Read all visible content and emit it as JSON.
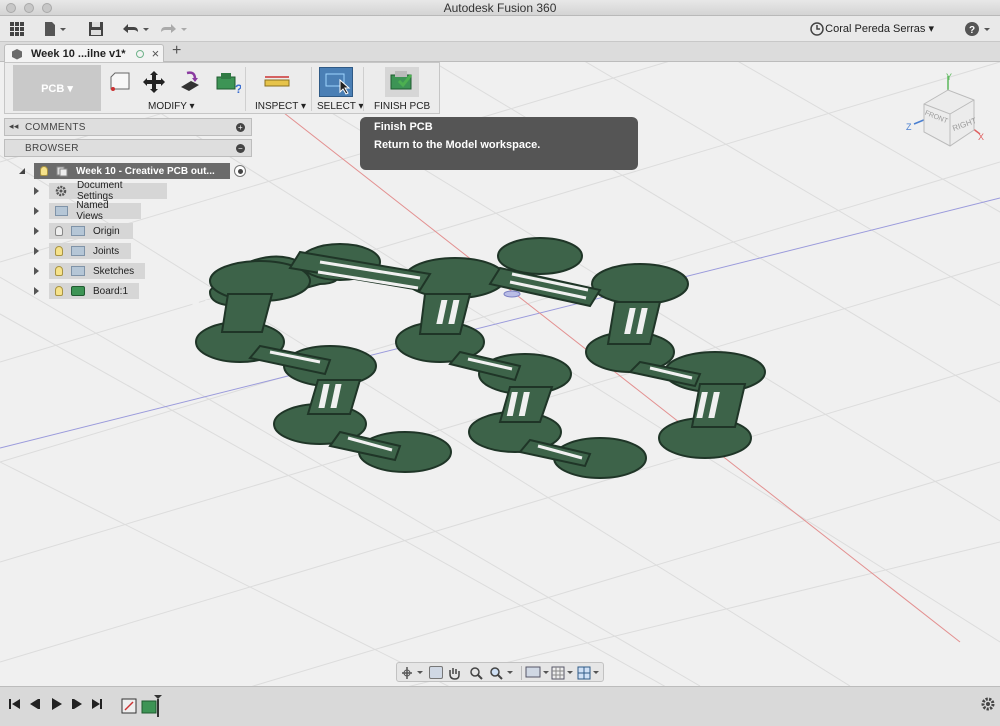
{
  "window": {
    "title": "Autodesk Fusion 360"
  },
  "quick_access": {
    "user_name": "Coral Pereda Serras",
    "icons": [
      "grid-menu-icon",
      "file-icon",
      "save-icon",
      "undo-icon",
      "redo-icon",
      "clock-icon",
      "help-icon"
    ]
  },
  "tab": {
    "label": "Week 10 ...ilne v1*",
    "close": "×",
    "add": "+"
  },
  "toolbar": {
    "workspace_label": "PCB ▾",
    "modify_label": "MODIFY ▾",
    "inspect_label": "INSPECT ▾",
    "select_label": "SELECT ▾",
    "finish_label": "FINISH PCB"
  },
  "tooltip": {
    "title": "Finish PCB",
    "description": "Return to the Model workspace."
  },
  "panels": {
    "comments": "COMMENTS",
    "browser": "BROWSER"
  },
  "browser": {
    "root": "Week 10 - Creative PCB out...",
    "items": [
      {
        "label": "Document Settings",
        "icon": "gear-icon"
      },
      {
        "label": "Named Views",
        "icon": "folder-icon"
      },
      {
        "label": "Origin",
        "icon": "folder-icon"
      },
      {
        "label": "Joints",
        "icon": "folder-icon"
      },
      {
        "label": "Sketches",
        "icon": "folder-icon"
      },
      {
        "label": "Board:1",
        "icon": "board-icon"
      }
    ]
  },
  "viewcube": {
    "face_label": "RIGHT",
    "side_label": "FRONT",
    "axis_x": "X",
    "axis_y": "Y",
    "axis_z": "Z"
  },
  "colors": {
    "board": "#3d6349",
    "board_edge": "#1f3527",
    "tooltip_bg": "#555555",
    "select_active": "#4a7fb5"
  }
}
